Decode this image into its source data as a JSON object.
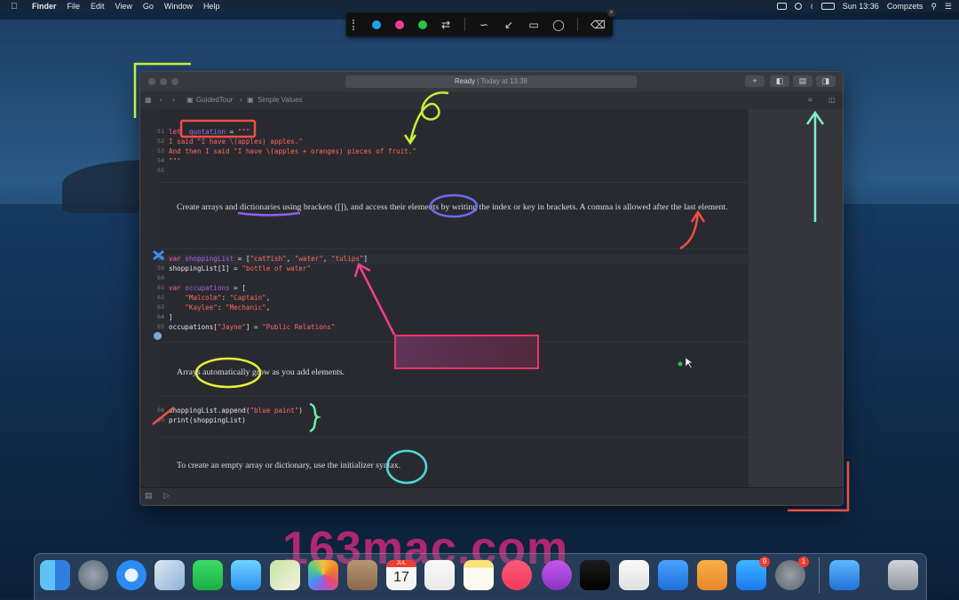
{
  "menubar": {
    "app": "Finder",
    "items": [
      "File",
      "Edit",
      "View",
      "Go",
      "Window",
      "Help"
    ],
    "clock": "Sun 13:36",
    "user": "Compzets"
  },
  "window": {
    "status_text": "Ready",
    "status_time": "Today at 13:38",
    "breadcrumb": [
      "GuidedTour",
      "Simple Values"
    ]
  },
  "code": {
    "block1": [
      {
        "n": "51",
        "parts": [
          [
            "kw",
            "let"
          ],
          [
            "",
            "  "
          ],
          [
            "var",
            "quotation"
          ],
          [
            "",
            " = "
          ],
          [
            "str",
            "\"\"\""
          ]
        ]
      },
      {
        "n": "52",
        "parts": [
          [
            "str",
            "I said \"I have \\(apples) apples.\""
          ]
        ]
      },
      {
        "n": "53",
        "parts": [
          [
            "str",
            "And then I said \"I have \\(apples + oranges) pieces of fruit.\""
          ]
        ]
      },
      {
        "n": "54",
        "parts": [
          [
            "str",
            "\"\"\""
          ]
        ]
      },
      {
        "n": "55",
        "parts": [
          [
            "",
            ""
          ]
        ]
      }
    ],
    "block2": [
      {
        "n": "58",
        "parts": [
          [
            "kw",
            "var"
          ],
          [
            "",
            " "
          ],
          [
            "var",
            "shoppingList"
          ],
          [
            "",
            " = ["
          ],
          [
            "str",
            "\"catfish\""
          ],
          [
            "",
            ", "
          ],
          [
            "str",
            "\"water\""
          ],
          [
            "",
            ", "
          ],
          [
            "str",
            "\"tulips\""
          ],
          [
            "",
            "]"
          ]
        ]
      },
      {
        "n": "59",
        "parts": [
          [
            "",
            "shoppingList[1] = "
          ],
          [
            "str",
            "\"bottle of water\""
          ]
        ]
      },
      {
        "n": "60",
        "parts": [
          [
            "",
            ""
          ]
        ]
      },
      {
        "n": "61",
        "parts": [
          [
            "kw",
            "var"
          ],
          [
            "",
            " "
          ],
          [
            "var",
            "occupations"
          ],
          [
            "",
            " = ["
          ]
        ]
      },
      {
        "n": "62",
        "parts": [
          [
            "",
            "    "
          ],
          [
            "str",
            "\"Malcolm\""
          ],
          [
            "",
            ": "
          ],
          [
            "str",
            "\"Captain\""
          ],
          [
            "",
            ","
          ]
        ]
      },
      {
        "n": "63",
        "parts": [
          [
            "",
            "    "
          ],
          [
            "str",
            "\"Kaylee\""
          ],
          [
            "",
            ": "
          ],
          [
            "str",
            "\"Mechanic\""
          ],
          [
            "",
            ","
          ]
        ]
      },
      {
        "n": "64",
        "parts": [
          [
            "",
            "]"
          ]
        ]
      },
      {
        "n": "65",
        "parts": [
          [
            "",
            "occupations["
          ],
          [
            "str",
            "\"Jayne\""
          ],
          [
            "",
            "] = "
          ],
          [
            "str",
            "\"Public Relations\""
          ]
        ]
      }
    ],
    "block3": [
      {
        "n": "68",
        "parts": [
          [
            "",
            "shoppingList.append("
          ],
          [
            "str",
            "\"blue paint\""
          ],
          [
            "",
            ")"
          ]
        ]
      },
      {
        "n": "69",
        "parts": [
          [
            "",
            "print(shoppingList)"
          ]
        ]
      }
    ]
  },
  "docs": {
    "p1": "Create arrays and dictionaries using brackets ([]), and access their elements by writing the index or key in brackets. A comma is allowed after the last element.",
    "p2": "Arrays automatically grow as you add elements.",
    "p3": "To create an empty array or dictionary, use the initializer syntax."
  },
  "annotation_colors": {
    "blue": "#1ea1f2",
    "pink": "#ef3f8f",
    "green": "#22c64a"
  },
  "annotation_number": "6",
  "dock": {
    "icons": [
      "finder-icon",
      "launchpad-icon",
      "safari-icon",
      "mail-icon",
      "facetime-icon",
      "messages-icon",
      "maps-icon",
      "photos-icon",
      "contacts-icon",
      "calendar-icon",
      "reminders-icon",
      "notes-icon",
      "music-icon",
      "podcasts-icon",
      "tv-icon",
      "numbers-icon",
      "keynote-icon",
      "pages-icon",
      "app-store-icon",
      "system-preferences-icon",
      "xcode-icon",
      "trash-icon"
    ],
    "calendar_month": "JUL",
    "calendar_day": "17",
    "app_store_badge": "9",
    "prefs_badge": "1"
  },
  "watermark": "163mac.com"
}
